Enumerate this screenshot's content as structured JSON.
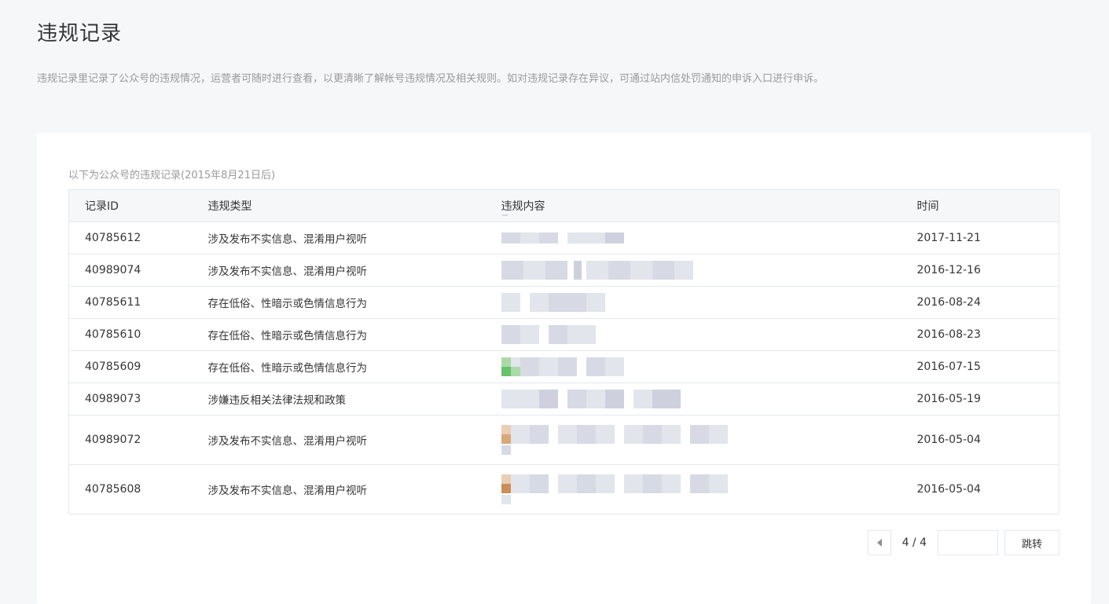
{
  "page": {
    "title": "违规记录",
    "description": "违规记录里记录了公众号的违规情况，运营者可随时进行查看，以更清晰了解帐号违规情况及相关规则。如对违规记录存在异议，可通过站内信处罚通知的申诉入口进行申诉。"
  },
  "card": {
    "caption": "以下为公众号的违规记录(2015年8月21日后)"
  },
  "table": {
    "headers": {
      "id": "记录ID",
      "type": "违规类型",
      "content": "违规内容",
      "time": "时间"
    },
    "rows": [
      {
        "id": "40785612",
        "type": "涉及发布不实信息、混淆用户视听",
        "time": "2017-11-21"
      },
      {
        "id": "40989074",
        "type": "涉及发布不实信息、混淆用户视听",
        "time": "2016-12-16"
      },
      {
        "id": "40785611",
        "type": "存在低俗、性暗示或色情信息行为",
        "time": "2016-08-24"
      },
      {
        "id": "40785610",
        "type": "存在低俗、性暗示或色情信息行为",
        "time": "2016-08-23"
      },
      {
        "id": "40785609",
        "type": "存在低俗、性暗示或色情信息行为",
        "time": "2016-07-15"
      },
      {
        "id": "40989073",
        "type": "涉嫌违反相关法律法规和政策",
        "time": "2016-05-19"
      },
      {
        "id": "40989072",
        "type": "涉及发布不实信息、混淆用户视听",
        "time": "2016-05-04"
      },
      {
        "id": "40785608",
        "type": "涉及发布不实信息、混淆用户视听",
        "time": "2016-05-04"
      }
    ]
  },
  "pagination": {
    "current": "4 / 4",
    "jump_value": "",
    "jump_label": "跳转"
  },
  "colors": {
    "background": "#f6f7f9",
    "card": "#ffffff",
    "border": "#e4e8eb",
    "muted_text": "#9a9a9a"
  },
  "icons": {
    "prev": "triangle-left-icon"
  }
}
